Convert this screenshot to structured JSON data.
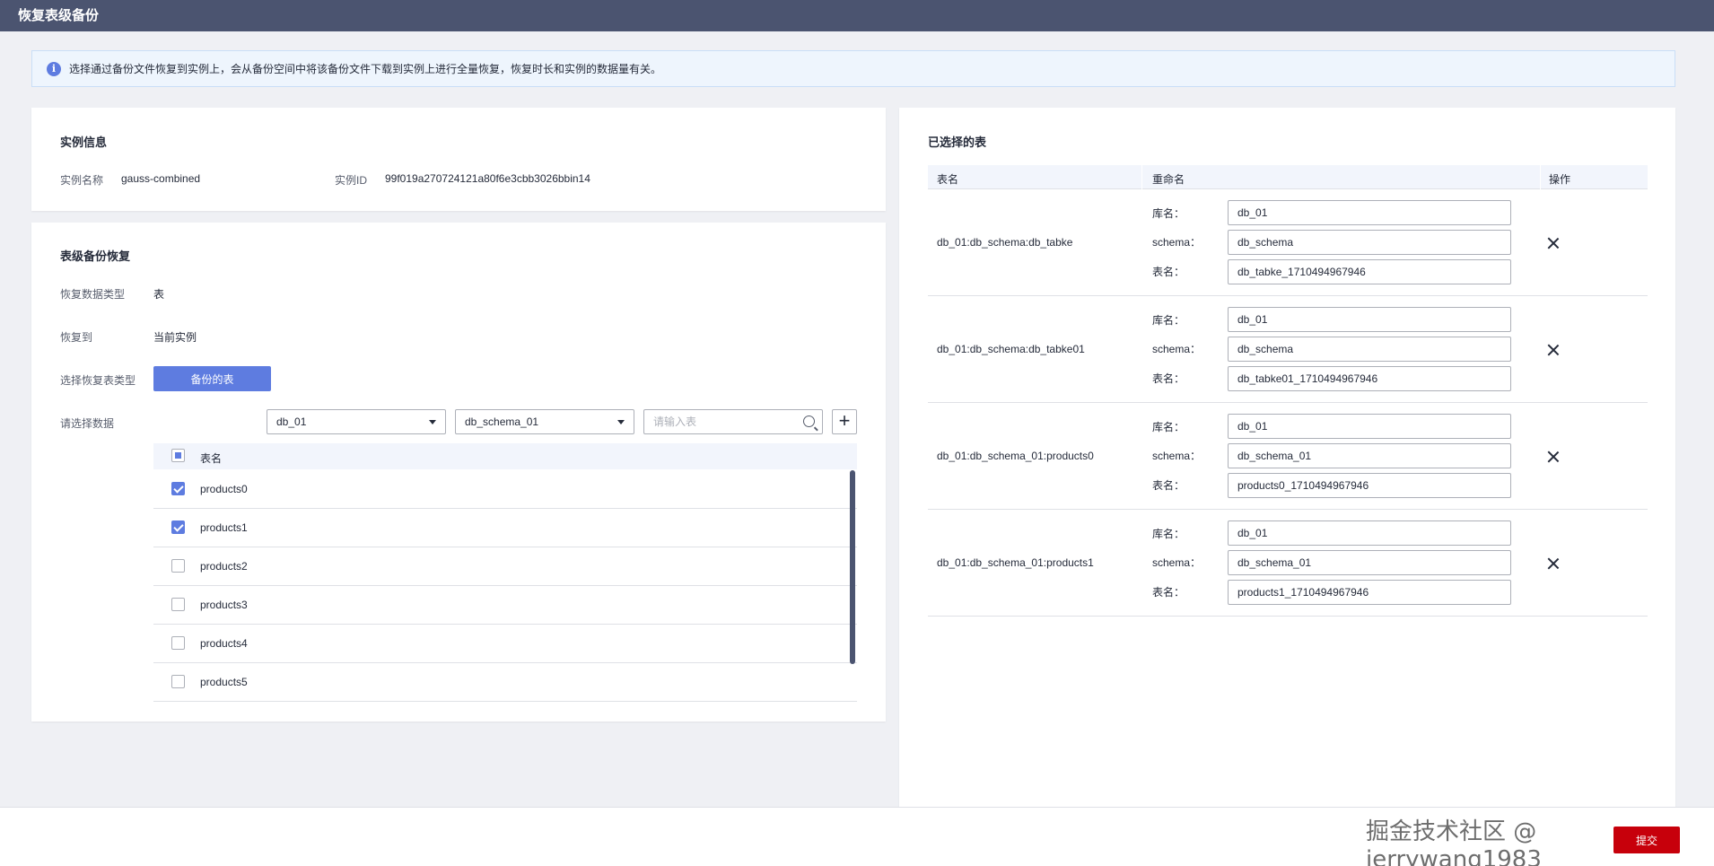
{
  "title": "恢复表级备份",
  "notice": "选择通过备份文件恢复到实例上，会从备份空间中将该备份文件下载到实例上进行全量恢复，恢复时长和实例的数据量有关。",
  "instance": {
    "section_title": "实例信息",
    "name_label": "实例名称",
    "name_value": "gauss-combined",
    "id_label": "实例ID",
    "id_value": "99f019a270724121a80f6e3cbb3026bbin14"
  },
  "restore": {
    "section_title": "表级备份恢复",
    "data_type_label": "恢复数据类型",
    "data_type_value": "表",
    "restore_to_label": "恢复到",
    "restore_to_value": "当前实例",
    "table_type_label": "选择恢复表类型",
    "table_type_button": "备份的表",
    "select_data_label": "请选择数据",
    "db_select": "db_01",
    "schema_select": "db_schema_01",
    "search_placeholder": "请输入表",
    "table_header": "表名",
    "tables": [
      {
        "name": "products0",
        "checked": true
      },
      {
        "name": "products1",
        "checked": true
      },
      {
        "name": "products2",
        "checked": false
      },
      {
        "name": "products3",
        "checked": false
      },
      {
        "name": "products4",
        "checked": false
      },
      {
        "name": "products5",
        "checked": false
      }
    ]
  },
  "selected": {
    "section_title": "已选择的表",
    "col_table": "表名",
    "col_rename": "重命名",
    "col_action": "操作",
    "db_label": "库名：",
    "schema_label": "schema：",
    "table_label": "表名：",
    "rows": [
      {
        "table": "db_01:db_schema:db_tabke",
        "db": "db_01",
        "schema": "db_schema",
        "newname": "db_tabke_1710494967946"
      },
      {
        "table": "db_01:db_schema:db_tabke01",
        "db": "db_01",
        "schema": "db_schema",
        "newname": "db_tabke01_1710494967946"
      },
      {
        "table": "db_01:db_schema_01:products0",
        "db": "db_01",
        "schema": "db_schema_01",
        "newname": "products0_1710494967946"
      },
      {
        "table": "db_01:db_schema_01:products1",
        "db": "db_01",
        "schema": "db_schema_01",
        "newname": "products1_1710494967946"
      }
    ]
  },
  "footer": {
    "submit_label": "提交",
    "watermark": "掘金技术社区 @ jerrywang1983"
  },
  "colors": {
    "header_bg": "#4b5470",
    "primary": "#5e7ce0",
    "submit": "#c7000b"
  }
}
